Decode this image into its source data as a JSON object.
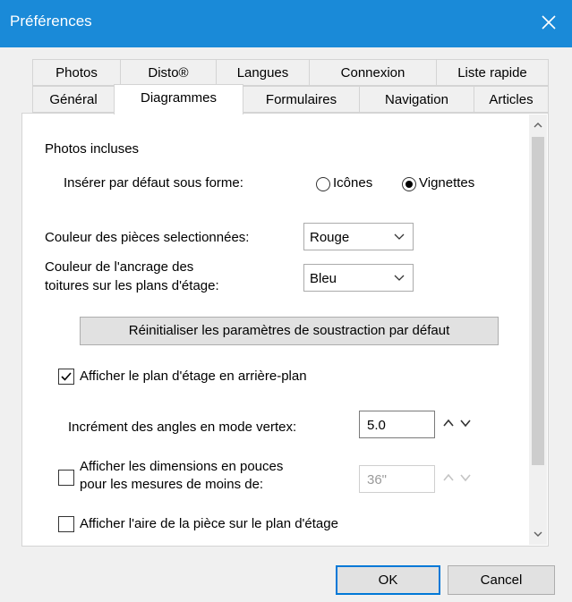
{
  "window": {
    "title": "Préférences"
  },
  "tabs_row1": [
    "Photos",
    "Disto®",
    "Langues",
    "Connexion",
    "Liste rapide"
  ],
  "tabs_row2": [
    "Général",
    "Diagrammes",
    "Formulaires",
    "Navigation",
    "Articles"
  ],
  "active_tab": "Diagrammes",
  "photos": {
    "section_label": "Photos incluses",
    "insert_label": "Insérer par défaut sous forme:",
    "options": [
      "Icônes",
      "Vignettes"
    ],
    "selected": "Vignettes"
  },
  "room_color": {
    "label": "Couleur des pièces selectionnées:",
    "value": "Rouge"
  },
  "roof_color": {
    "label_line1": "Couleur de l'ancrage des",
    "label_line2": "toitures sur les plans d'étage:",
    "value": "Bleu"
  },
  "reset_button": "Réinitialiser les paramètres de soustraction par défaut",
  "show_floorplan": {
    "label": "Afficher le plan d'étage en arrière-plan",
    "checked": true
  },
  "angle_increment": {
    "label": "Incrément des angles en mode vertex:",
    "value": "5.0"
  },
  "inch_dims": {
    "label_line1": "Afficher les dimensions en pouces",
    "label_line2": "pour les mesures de moins de:",
    "value": "36\"",
    "checked": false
  },
  "room_area": {
    "label": "Afficher l'aire de la pièce sur le plan d'étage",
    "checked": false
  },
  "buttons": {
    "ok": "OK",
    "cancel": "Cancel"
  },
  "colors": {
    "titlebar": "#1a8ad8",
    "ok_border": "#0078d7"
  }
}
